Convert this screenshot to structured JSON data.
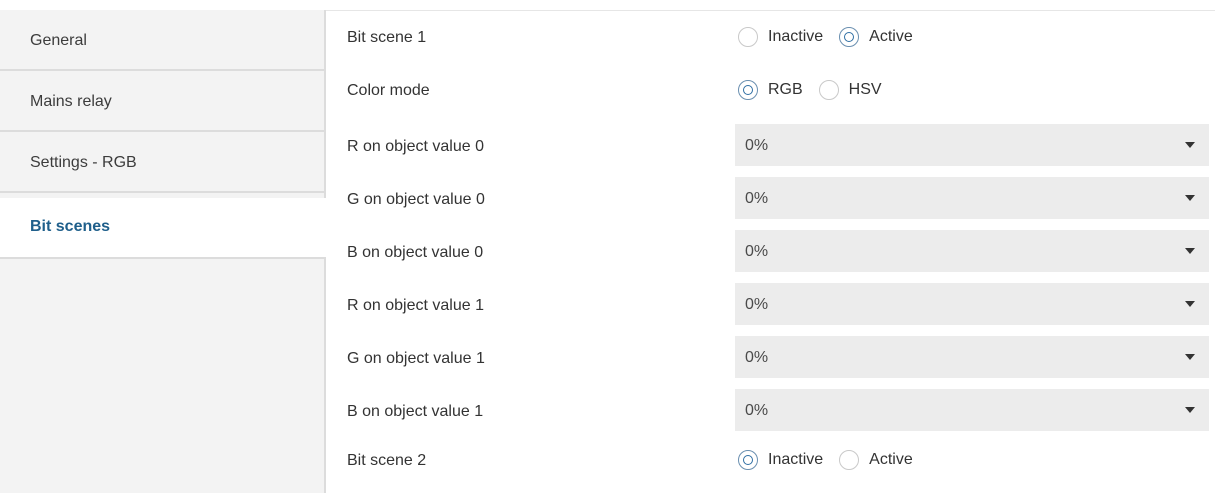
{
  "sidebar": {
    "items": [
      {
        "label": "General",
        "active": false
      },
      {
        "label": "Mains relay",
        "active": false
      },
      {
        "label": "Settings - RGB",
        "active": false
      },
      {
        "label": "Bit scenes",
        "active": true
      }
    ]
  },
  "params": {
    "bit_scene_1": {
      "label": "Bit scene 1",
      "options": [
        "Inactive",
        "Active"
      ],
      "selected": "Active"
    },
    "color_mode": {
      "label": "Color mode",
      "options": [
        "RGB",
        "HSV"
      ],
      "selected": "RGB"
    },
    "r_on_0": {
      "label": "R on object value 0",
      "value": "0%"
    },
    "g_on_0": {
      "label": "G on object value 0",
      "value": "0%"
    },
    "b_on_0": {
      "label": "B on object value 0",
      "value": "0%"
    },
    "r_on_1": {
      "label": "R on object value 1",
      "value": "0%"
    },
    "g_on_1": {
      "label": "G on object value 1",
      "value": "0%"
    },
    "b_on_1": {
      "label": "B on object value 1",
      "value": "0%"
    },
    "bit_scene_2": {
      "label": "Bit scene 2",
      "options": [
        "Inactive",
        "Active"
      ],
      "selected": "Inactive"
    }
  },
  "icons": {
    "dropdown_caret": "chevron-down-icon"
  },
  "colors": {
    "active_tab_text": "#1f5f8b",
    "sidebar_background": "#f3f3f3",
    "dropdown_background": "#ececec",
    "radio_selected": "#2e6ea3"
  }
}
